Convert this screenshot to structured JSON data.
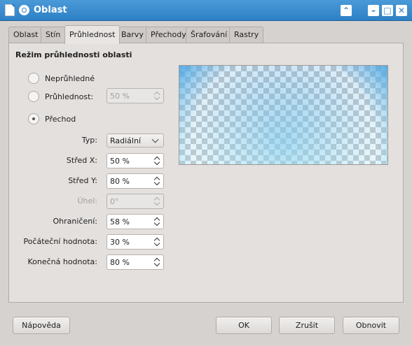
{
  "window": {
    "title": "Oblast"
  },
  "tabs": [
    {
      "label": "Oblast"
    },
    {
      "label": "Stín"
    },
    {
      "label": "Průhlednost"
    },
    {
      "label": "Barvy"
    },
    {
      "label": "Přechody"
    },
    {
      "label": "Šrafování"
    },
    {
      "label": "Rastry"
    }
  ],
  "active_tab": "Průhlednost",
  "section": {
    "title": "Režim průhlednosti oblasti"
  },
  "modes": {
    "opaque": {
      "label": "Neprůhledné",
      "checked": false
    },
    "transparency": {
      "label": "Průhlednost:",
      "value": "50 %",
      "checked": false
    },
    "gradient": {
      "label": "Přechod",
      "checked": true
    }
  },
  "fields": {
    "type": {
      "label": "Typ:",
      "value": "Radiální"
    },
    "center_x": {
      "label": "Střed X:",
      "value": "50 %"
    },
    "center_y": {
      "label": "Střed Y:",
      "value": "80 %"
    },
    "angle": {
      "label": "Úhel:",
      "value": "0°",
      "disabled": true
    },
    "border": {
      "label": "Ohraničení:",
      "value": "58 %"
    },
    "start_value": {
      "label": "Počáteční hodnota:",
      "value": "30 %"
    },
    "end_value": {
      "label": "Konečná hodnota:",
      "value": "80 %"
    }
  },
  "buttons": {
    "help": "Nápověda",
    "ok": "OK",
    "cancel": "Zrušit",
    "reset": "Obnovit"
  },
  "colors": {
    "titlebar": "#2e80c6",
    "preview_top": "#4ea7e3",
    "preview_bottom": "#8fd6f0"
  },
  "icons": [
    "document-icon",
    "menu-icon",
    "keep-above-icon",
    "minimize-icon",
    "maximize-icon",
    "close-icon"
  ]
}
